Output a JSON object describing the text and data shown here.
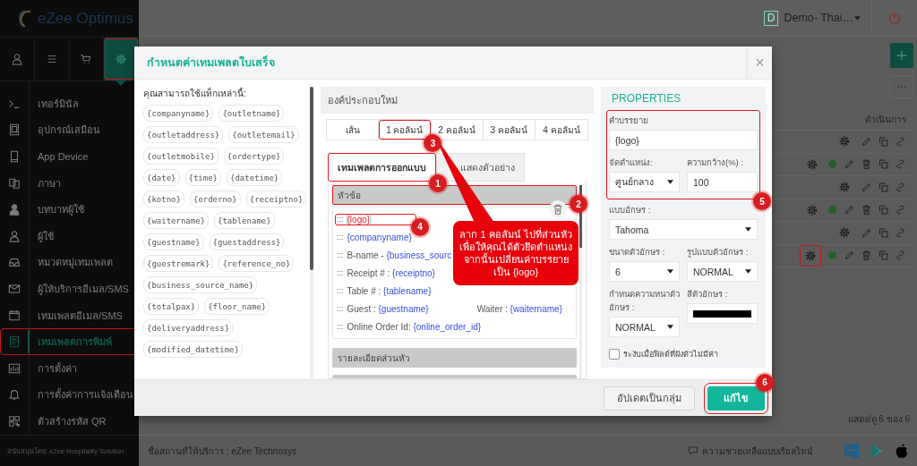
{
  "app": {
    "logo_text": "eZee Optimus"
  },
  "top_tabs": [
    {
      "selected": false,
      "highlighted": false
    },
    {
      "selected": false,
      "highlighted": false
    },
    {
      "selected": false,
      "highlighted": false
    },
    {
      "selected": true,
      "highlighted": true
    }
  ],
  "sidebar": {
    "items": [
      {
        "label": "เทอร์มินัล",
        "selected": false,
        "highlighted": false
      },
      {
        "label": "อุปกรณ์เสมือน",
        "selected": false,
        "highlighted": false
      },
      {
        "label": "App Device",
        "selected": false,
        "highlighted": false
      },
      {
        "label": "ภาษา",
        "selected": false,
        "highlighted": false
      },
      {
        "label": "บทบาทผู้ใช้",
        "selected": false,
        "highlighted": false
      },
      {
        "label": "ผู้ใช้",
        "selected": false,
        "highlighted": false
      },
      {
        "label": "หมวดหมู่เทมเพลต",
        "selected": false,
        "highlighted": false
      },
      {
        "label": "ผู้ให้บริการอีเมล/SMS",
        "selected": false,
        "highlighted": false
      },
      {
        "label": "เทมเพลตอีเมล/SMS",
        "selected": false,
        "highlighted": false
      },
      {
        "label": "เทมเพลตการพิมพ์",
        "selected": true,
        "highlighted": true
      },
      {
        "label": "การตั้งค่า",
        "selected": false,
        "highlighted": false
      },
      {
        "label": "การตั้งค่าการแจ้งเตือน",
        "selected": false,
        "highlighted": false
      },
      {
        "label": "ตัวสร้างรหัส QR",
        "selected": false,
        "highlighted": false
      }
    ],
    "footer": "สนับสนุนโดย: eZee Hospitality Solution"
  },
  "topbar": {
    "property_badge": "D",
    "property_name": "Demo- Thai…"
  },
  "table": {
    "action_header": "ดำเนินการ",
    "rows": [
      {
        "active": false,
        "highlighted": false
      },
      {
        "active": true,
        "highlighted": false
      },
      {
        "active": false,
        "highlighted": false
      },
      {
        "active": true,
        "highlighted": false
      },
      {
        "active": false,
        "highlighted": false
      },
      {
        "active": true,
        "highlighted": true
      }
    ],
    "footer": "แสดง/ดู 6 ของ 6"
  },
  "status_bar": {
    "service_place": "ชื่อสถานที่ให้บริการ : eZee Technosys",
    "help": "ความช่วยเหลือแบบเรียลไทม์"
  },
  "modal": {
    "title": "กำหนดค่าเทมเพลตใบเสร็จ",
    "close": "×",
    "tags_heading": "คุณสามารถใช้แท็กเหล่านี้:",
    "tags": [
      "{companyname}",
      "{outletname}",
      "{outletaddress}",
      "{outletemail}",
      "{outletmobile}",
      "{ordertype}",
      "{date}",
      "{time}",
      "{datetime}",
      "{kotno}",
      "{orderno}",
      "{receiptno}",
      "{waitername}",
      "{tablename}",
      "{guestname}",
      "{guestaddress}",
      "{guestremark}",
      "{reference_no}",
      "{business_source_name}",
      "{totalpax}",
      "{floor_name}",
      "{deliveryaddress}",
      "{modified_datetime}"
    ],
    "new_elements": {
      "heading": "องค์ประกอบใหม่",
      "options": [
        {
          "label": "เส้น"
        },
        {
          "label": "1 คอลัมน์",
          "annotation": "3"
        },
        {
          "label": "2 คอลัมน์"
        },
        {
          "label": "3 คอลัมน์"
        },
        {
          "label": "4 คอลัมน์"
        }
      ]
    },
    "view_tabs": [
      {
        "label": "เทมเพลตการออกแบบ",
        "selected": true,
        "annotation": "1"
      },
      {
        "label": "แสดงตัวอย่าง",
        "selected": false
      }
    ],
    "sections": [
      {
        "title": "หัวข้อ",
        "annotation": "2",
        "lines": [
          {
            "handle": ":::",
            "selected": true,
            "annotation": "4",
            "cells": [
              {
                "tag": "{logo}"
              }
            ]
          },
          {
            "handle": ":::",
            "selected": false,
            "cells": [
              {
                "tag": "{companyname}"
              }
            ]
          },
          {
            "handle": ":::",
            "selected": false,
            "cells": [
              {
                "label": "B-name - ",
                "tag": "{business_sourc"
              }
            ]
          },
          {
            "handle": ":::",
            "selected": false,
            "cells": [
              {
                "label": "Receipt # : ",
                "tag": "{receiptno}"
              }
            ]
          },
          {
            "handle": ":::",
            "selected": false,
            "cells": [
              {
                "label": "Table # : ",
                "tag": "{tablename}"
              }
            ]
          },
          {
            "handle": ":::",
            "selected": false,
            "cells": [
              {
                "label": "Guest : ",
                "tag": "{guestname}"
              },
              {
                "label": "Waiter : ",
                "tag": "{waitername}"
              }
            ]
          },
          {
            "handle": ":::",
            "selected": false,
            "cells": [
              {
                "label": "Online Order Id: ",
                "tag": "{online_order_id}"
              }
            ]
          }
        ]
      },
      {
        "title": "รายละเอียดส่วนหัว"
      }
    ],
    "callout": "ลาก 1 คอลัมน์ ไปที่ส่วนหัว เพื่อให้คุณได้ตัวยึดตำแหน่ง จากนั้นเปลี่ยนค่าบรรยายเป็น {logo}",
    "properties": {
      "title": "PROPERTIES",
      "groups": [
        {
          "annotation": "5",
          "fields": [
            {
              "label": "คำบรรยาย",
              "value": "{logo}",
              "kind": "text",
              "full": true
            },
            {
              "label": "จัดตำแหน่ง:",
              "value": "ศูนย์กลาง",
              "kind": "select",
              "full": false
            },
            {
              "label": "ความกว้าง(%) :",
              "value": "100",
              "kind": "text",
              "full": false
            }
          ]
        },
        {
          "fields": [
            {
              "label": "แบบอักษร :",
              "value": "Tahoma",
              "kind": "select",
              "full": true
            },
            {
              "label": "ขนาดตัวอักษร :",
              "value": "6",
              "kind": "select",
              "full": false
            },
            {
              "label": "รูปแบบตัวอักษร :",
              "value": "NORMAL",
              "kind": "select",
              "full": false
            },
            {
              "label": "กำหนดความหนาตัวอักษร :",
              "value": "NORMAL",
              "kind": "select",
              "full": false
            },
            {
              "label": "สีตัวอักษร :",
              "color": "#000000",
              "kind": "color",
              "full": false
            }
          ]
        }
      ],
      "checkbox": {
        "label": "ระงับเมื่อฟิลด์ที่ฝังตัวไม่มีค่า",
        "checked": false
      }
    },
    "buttons": [
      {
        "label": "อัปเดตเป็นกลุ่ม",
        "kind": "secondary"
      },
      {
        "label": "แก้ไข",
        "kind": "primary",
        "annotation": "6"
      }
    ]
  }
}
